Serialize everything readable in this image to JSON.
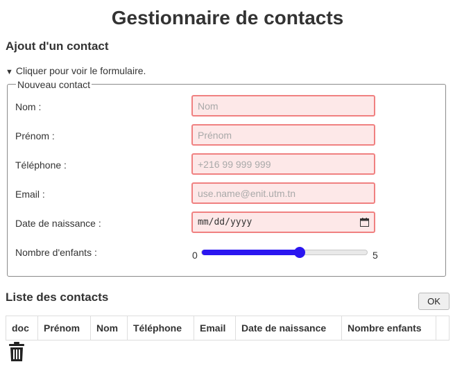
{
  "page": {
    "title": "Gestionnaire de contacts"
  },
  "add_section": {
    "heading": "Ajout d'un contact",
    "summary_text": "Cliquer pour voir le formulaire.",
    "summary_icon": "triangle-down-icon"
  },
  "form": {
    "legend": "Nouveau contact",
    "nom": {
      "label": "Nom :",
      "placeholder": "Nom",
      "value": ""
    },
    "prenom": {
      "label": "Prénom :",
      "placeholder": "Prénom",
      "value": ""
    },
    "telephone": {
      "label": "Téléphone :",
      "placeholder": "+216 99 999 999",
      "value": ""
    },
    "email": {
      "label": "Email :",
      "placeholder": "use.name@enit.utm.tn",
      "value": ""
    },
    "date_naissance": {
      "label": "Date de naissance :",
      "display": "mm/dd/yyyy",
      "icon": "calendar-icon"
    },
    "nombre_enfants": {
      "label": "Nombre d'enfants :",
      "min": "0",
      "max": "5",
      "value": 3
    },
    "invalid_border_color": "#f08080",
    "invalid_background_color": "#fde8e8",
    "slider_accent_color": "#2b16f0"
  },
  "list_section": {
    "heading": "Liste des contacts",
    "ok_label": "OK",
    "columns": [
      "doc",
      "Prénom",
      "Nom",
      "Téléphone",
      "Email",
      "Date de naissance",
      "Nombre enfants",
      ""
    ],
    "row_icon": "trash-icon"
  }
}
